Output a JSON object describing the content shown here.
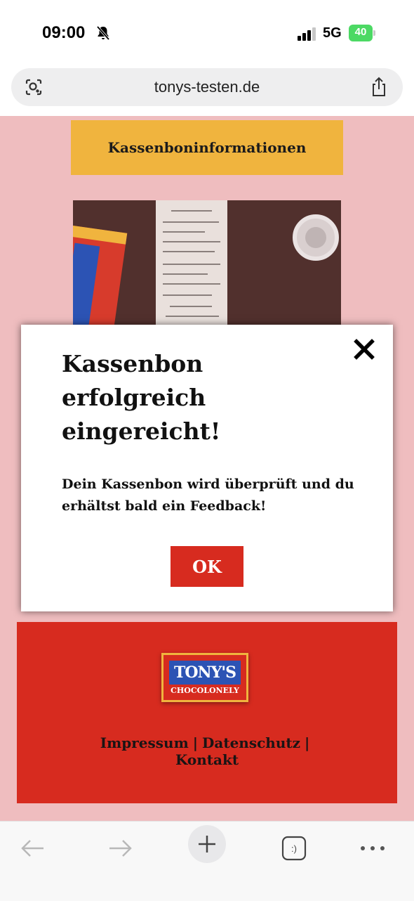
{
  "status_bar": {
    "time": "09:00",
    "network": "5G",
    "battery": "40"
  },
  "browser": {
    "url": "tonys-testen.de"
  },
  "page": {
    "receipt_heading": "Kassenboninformationen"
  },
  "modal": {
    "title": "Kassenbon erfolgreich eingereicht!",
    "message": "Dein Kassenbon wird überprüft und du erhältst bald ein Feedback!",
    "ok_label": "OK"
  },
  "footer": {
    "logo_text": "TONY'S",
    "logo_subtext": "CHOCOLONELY",
    "links": [
      "Impressum",
      "Datenschutz",
      "Kontakt"
    ],
    "separator": "|"
  },
  "toolbar": {
    "tabs_label": ":)"
  },
  "colors": {
    "page_background": "#efbdbf",
    "heading_background": "#f0b43e",
    "brand_red": "#d72b1f",
    "battery_green": "#4cd964"
  },
  "icons": [
    "bell-slash-icon",
    "signal-icon",
    "battery-icon",
    "lens-icon",
    "share-icon",
    "close-icon",
    "back-arrow-icon",
    "forward-arrow-icon",
    "plus-icon",
    "tabs-icon",
    "more-icon"
  ]
}
